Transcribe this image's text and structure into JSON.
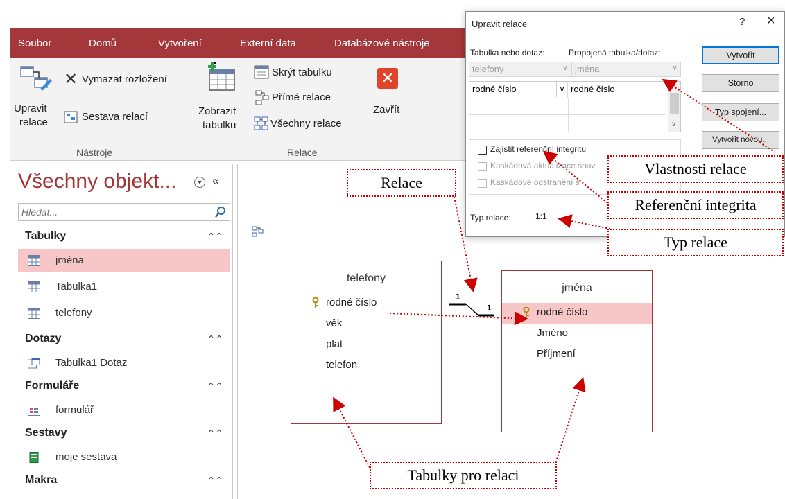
{
  "ribbon": {
    "tabs": [
      "Soubor",
      "Domů",
      "Vytvoření",
      "Externí data",
      "Databázové nástroje"
    ],
    "tools": {
      "edit_relations": [
        "Upravit",
        "relace"
      ],
      "clear_layout": "Vymazat rozložení",
      "relation_report": "Sestava relací",
      "show_table": [
        "Zobrazit",
        "tabulku"
      ],
      "hide_table": "Skrýt tabulku",
      "direct_relations": "Přímé relace",
      "all_relations": "Všechny relace",
      "close": "Zavřít"
    },
    "groups": {
      "tools": "Nástroje",
      "relations": "Relace"
    }
  },
  "nav": {
    "title": "Všechny objekt...",
    "search_placeholder": "Hledat...",
    "categories": [
      {
        "label": "Tabulky",
        "items": [
          {
            "label": "jména",
            "icon": "table-icon",
            "selected": true
          },
          {
            "label": "Tabulka1",
            "icon": "table-icon"
          },
          {
            "label": "telefony",
            "icon": "table-icon"
          }
        ]
      },
      {
        "label": "Dotazy",
        "items": [
          {
            "label": "Tabulka1 Dotaz",
            "icon": "query-icon"
          }
        ]
      },
      {
        "label": "Formuláře",
        "items": [
          {
            "label": "formulář",
            "icon": "form-icon"
          }
        ]
      },
      {
        "label": "Sestavy",
        "items": [
          {
            "label": "moje sestava",
            "icon": "report-icon"
          }
        ]
      },
      {
        "label": "Makra",
        "items": []
      }
    ]
  },
  "tables": [
    {
      "title": "telefony",
      "fields": [
        "rodné číslo",
        "věk",
        "plat",
        "telefon"
      ],
      "key_field": "rodné číslo"
    },
    {
      "title": "jména",
      "fields": [
        "rodné číslo",
        "Jméno",
        "Příjmení"
      ],
      "key_field": "rodné číslo"
    }
  ],
  "relationship": {
    "left_label": "1",
    "right_label": "1"
  },
  "dialog": {
    "title": "Upravit relace",
    "help": "?",
    "close": "×",
    "table_label": "Tabulka nebo dotaz:",
    "related_label": "Propojená tabulka/dotaz:",
    "table_value": "telefony",
    "related_value": "jména",
    "grid_left": "rodné číslo",
    "grid_right": "rodné číslo",
    "referential_integrity": "Zajistit referenční integritu",
    "cascade_update": "Kaskádová aktualizace souv",
    "cascade_delete": "Kaskádové odstranění s",
    "relation_type_label": "Typ relace:",
    "relation_type_value": "1:1",
    "buttons": {
      "create": "Vytvořit",
      "cancel": "Storno",
      "join_type": "Typ spojení...",
      "create_new": "Vytvořit novou..."
    }
  },
  "callouts": {
    "relation": "Relace",
    "properties": "Vlastnosti relace",
    "integrity": "Referenční integrita",
    "type": "Typ relace",
    "tables": "Tabulky pro relaci"
  }
}
